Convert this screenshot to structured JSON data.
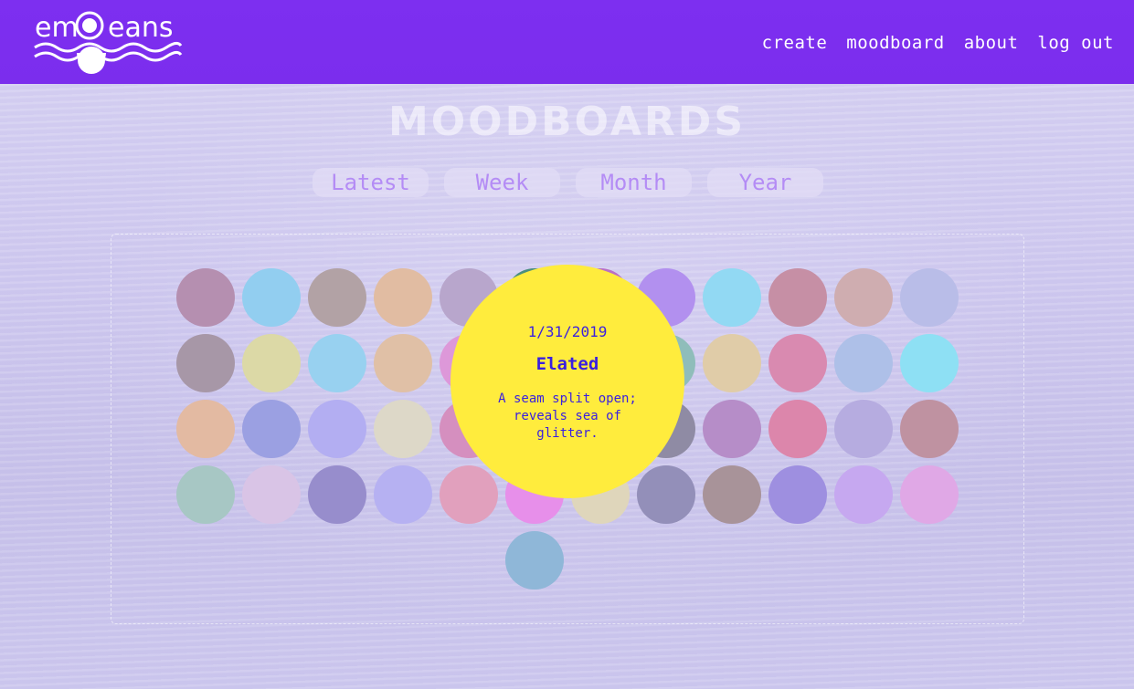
{
  "header": {
    "logo_text": "emOceans",
    "nav": [
      "create",
      "moodboard",
      "about",
      "log out"
    ]
  },
  "page_title": "MOODBOARDS",
  "tabs": [
    "Latest",
    "Week",
    "Month",
    "Year"
  ],
  "mood_colors": [
    "#b58fb0",
    "#92cef0",
    "#b2a2a5",
    "#e1bca2",
    "#b8a6cc",
    "#4b8f7f",
    "#b96fc6",
    "#b290ef",
    "#92d9f3",
    "#c68fa5",
    "#cfadb0",
    "#b9bde8",
    "#a797a7",
    "#dcd9a6",
    "#98d1f0",
    "#e0c0a6",
    "#dd98d9",
    "#e4c5c9",
    "#b1a8e2",
    "#8fbdba",
    "#e0cca8",
    "#d98ab0",
    "#aec0e8",
    "#8ee0f4",
    "#e3baa2",
    "#9ba0e2",
    "#b3aef2",
    "#ddd8c8",
    "#d58fbf",
    "#b598dd",
    "#ad8fa4",
    "#8f8ba4",
    "#b68dc8",
    "#dc86ab",
    "#b6ace0",
    "#bf92a1",
    "#a7c7c4",
    "#d9c4e6",
    "#978dcc",
    "#b6b1f2",
    "#e1a0bd",
    "#e78fea",
    "#dfd6bb",
    "#938fb9",
    "#a89399",
    "#9e8fe0",
    "#c6a8f0",
    "#e0a8e6",
    "#8fb7d8"
  ],
  "popup": {
    "date": "1/31/2019",
    "mood": "Elated",
    "note": "A seam split open; reveals sea of glitter.",
    "bg_color": "#ffec3d",
    "text_color": "#3a1fe0"
  }
}
